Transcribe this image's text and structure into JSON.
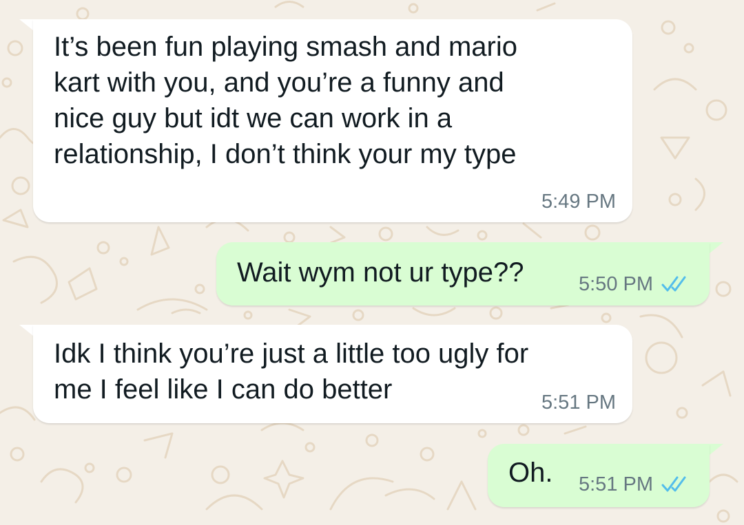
{
  "chat": {
    "messages": [
      {
        "direction": "incoming",
        "text": "It’s been fun playing smash and mario\nkart with you, and you’re a funny and\nnice guy but idt we can work in a\nrelationship, I don’t think your my type",
        "time": "5:49 PM"
      },
      {
        "direction": "outgoing",
        "text": "Wait wym not ur type??",
        "time": "5:50 PM",
        "status_icon": "double-check-read-icon"
      },
      {
        "direction": "incoming",
        "text": "Idk I think you’re just a little too ugly for\nme I feel like I can do better",
        "time": "5:51 PM"
      },
      {
        "direction": "outgoing",
        "text": "Oh.",
        "time": "5:51 PM",
        "status_icon": "double-check-read-icon"
      }
    ]
  },
  "colors": {
    "background": "#f4efe7",
    "incoming_bubble": "#ffffff",
    "outgoing_bubble": "#d9fdd3",
    "read_ticks": "#53bdeb",
    "timestamp": "#667781",
    "text": "#111b21",
    "doodle": "#e8dccb"
  }
}
